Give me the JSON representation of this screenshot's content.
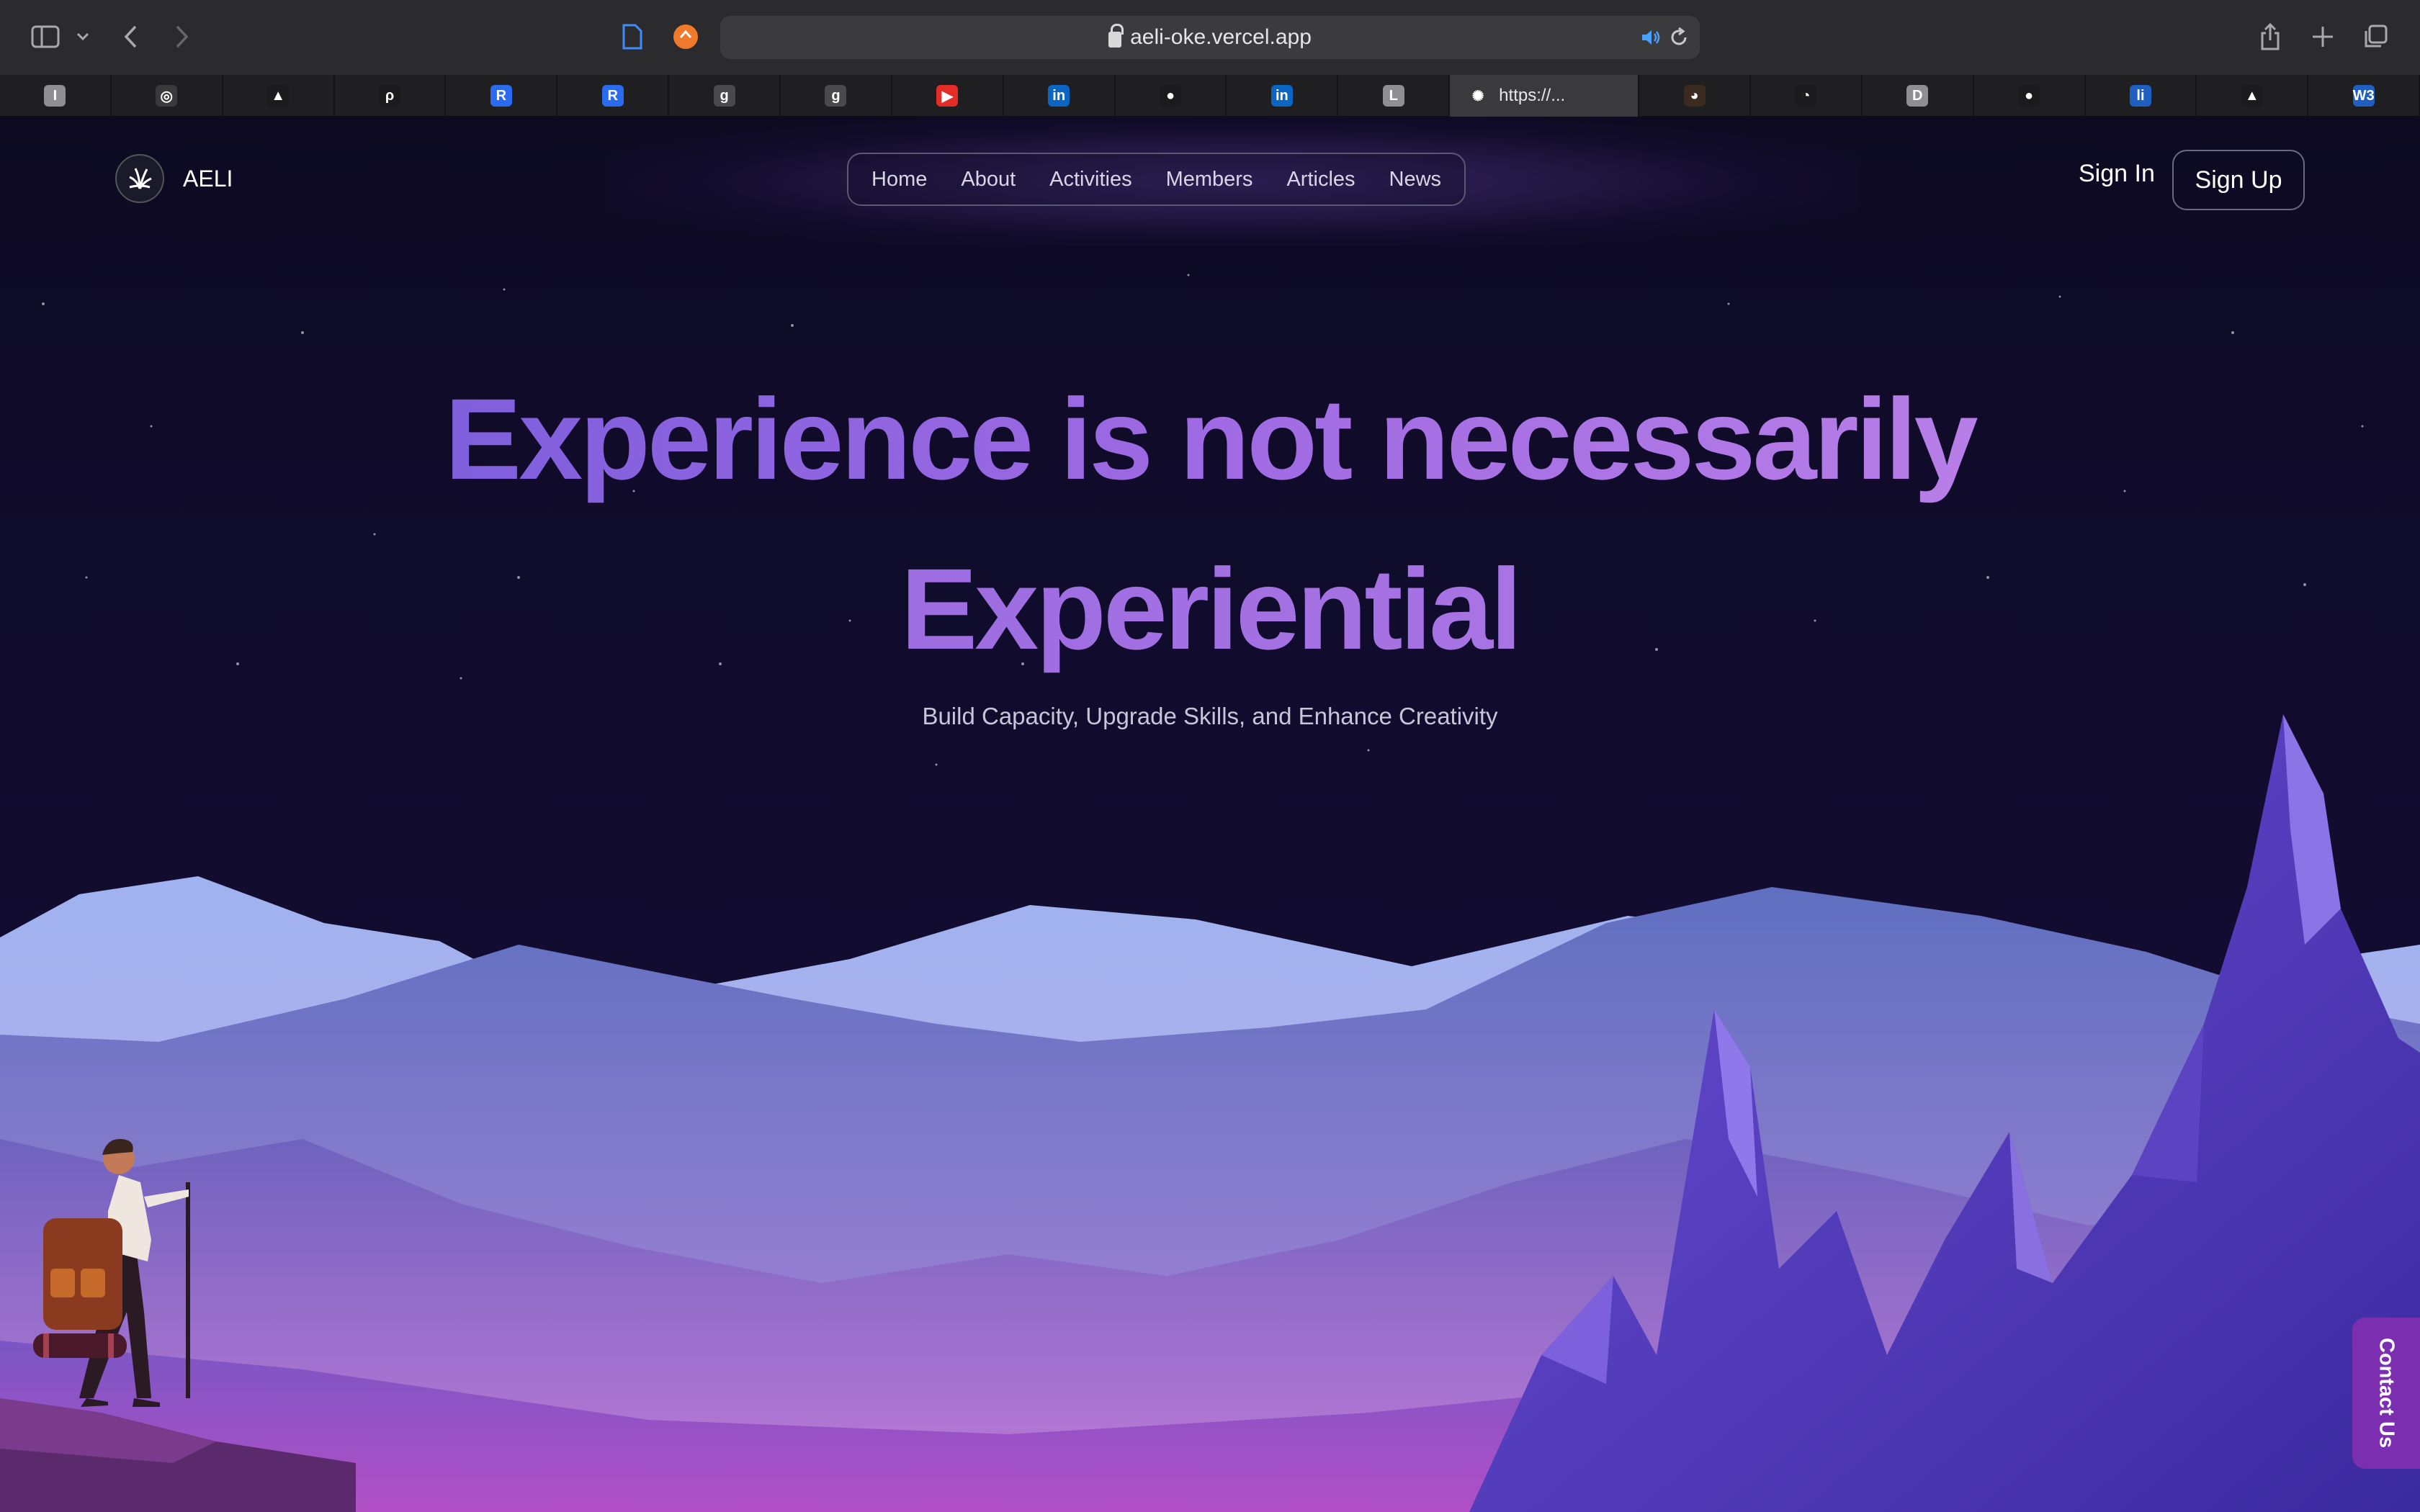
{
  "browser": {
    "url": "aeli-oke.vercel.app",
    "active_tab_label": "https://...",
    "tab_favicons": [
      "I",
      "openai",
      "A",
      "pycharm",
      "R",
      "R",
      "g",
      "g",
      "youtube",
      "in",
      "github",
      "in",
      "L",
      "aeli",
      "profile",
      "copilot",
      "D",
      "github",
      "live",
      "A",
      "W3"
    ]
  },
  "site": {
    "brand_name": "AELI",
    "nav": [
      "Home",
      "About",
      "Activities",
      "Members",
      "Articles",
      "News"
    ],
    "sign_in": "Sign In",
    "sign_up": "Sign Up"
  },
  "hero": {
    "line1": "Experience is not necessarily",
    "line2": "Experiential",
    "subtitle": "Build Capacity, Upgrade Skills, and Enhance Creativity"
  },
  "contact_label": "Contact Us",
  "colors": {
    "accent": "#9b6ae2",
    "background": "#0e0a24",
    "contact": "#7b2fb0"
  }
}
